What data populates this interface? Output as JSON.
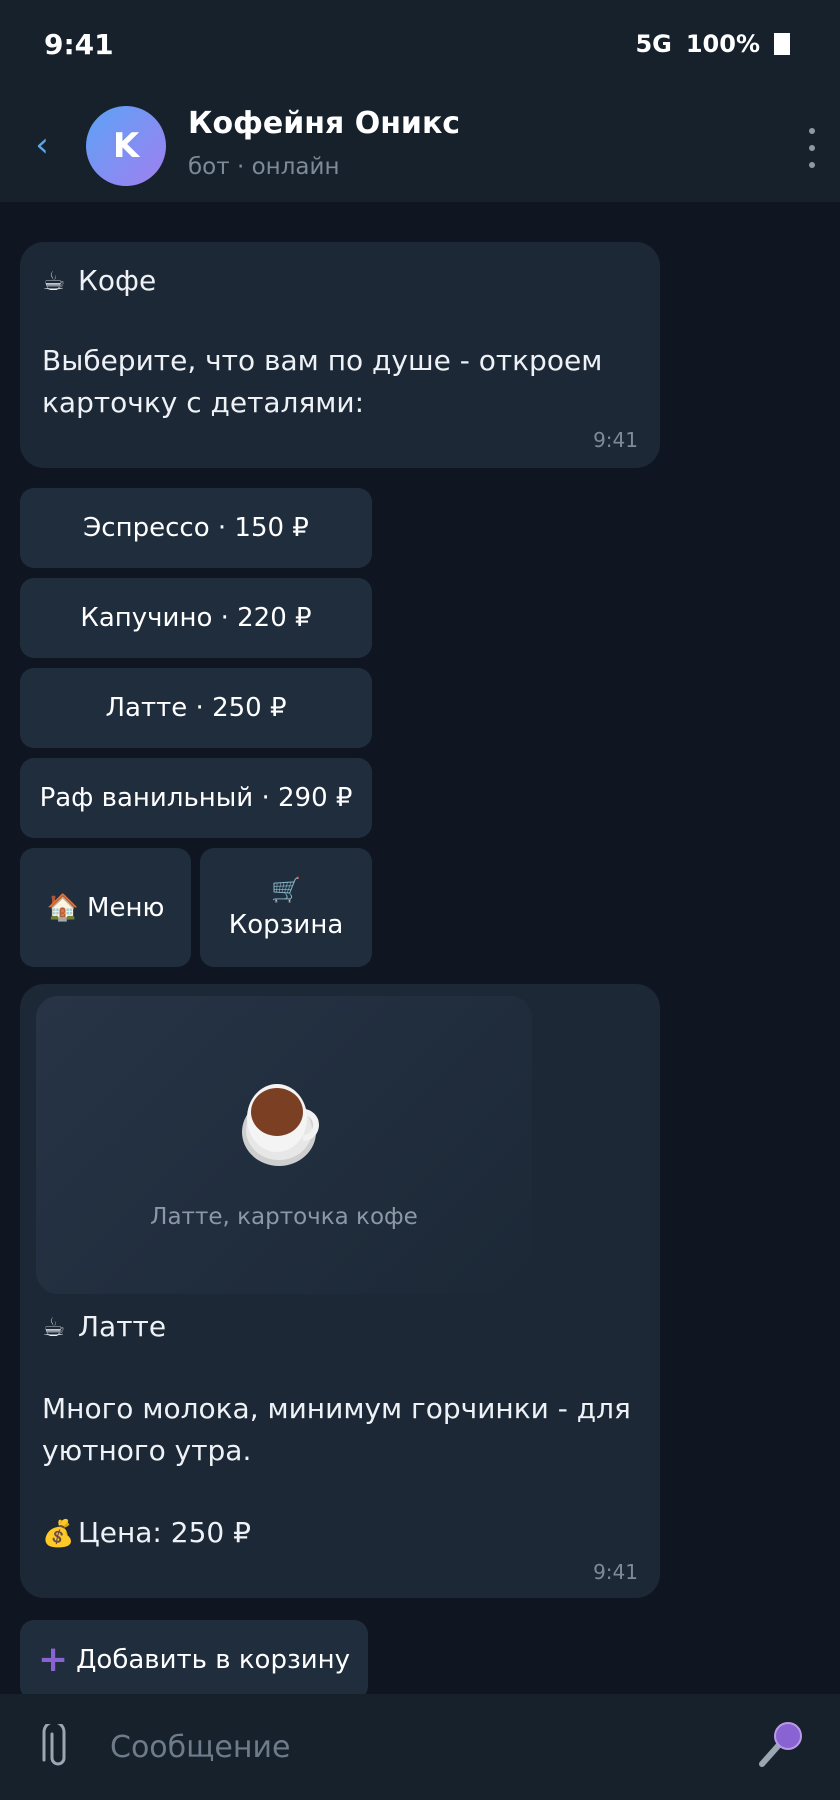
{
  "status": {
    "time": "9:41",
    "network": "5G",
    "battery": "100%"
  },
  "header": {
    "avatar_letter": "K",
    "title": "Кофейня Оникс",
    "subtitle": "бот · онлайн"
  },
  "message1": {
    "heading": "Кофе",
    "body_line1": "Выберите, что вам по душе - откроем",
    "body_line2": "карточку с деталями:",
    "time": "9:41"
  },
  "keyboard": {
    "items": [
      {
        "label": "Эспрессо · 150 ₽"
      },
      {
        "label": "Капучино · 220 ₽"
      },
      {
        "label": "Латте · 250 ₽"
      },
      {
        "label": "Раф ванильный · 290 ₽"
      }
    ],
    "menu_label": "Меню",
    "cart_label": "Корзина"
  },
  "message2": {
    "image_caption": "Латте, карточка кофе",
    "heading": "Латте",
    "body_line1": "Много молока, минимум горчинки - для",
    "body_line2": "уютного утра.",
    "price": "Цена: 250 ₽",
    "time": "9:41"
  },
  "add_to_cart_label": "Добавить в корзину",
  "composer": {
    "placeholder": "Сообщение"
  },
  "icons": {
    "back": "chevron-left-icon",
    "more": "more-vertical-icon",
    "coffee": "coffee-cup-icon",
    "home": "house-icon",
    "cart": "shopping-cart-icon",
    "money": "money-bag-icon",
    "plus": "plus-icon",
    "clip": "paperclip-icon",
    "mic": "microphone-icon"
  },
  "colors": {
    "background": "#0f1621",
    "bar": "#17212b",
    "bubble": "#1c2836",
    "button": "#1f2d3d",
    "accent": "#5ea5e8",
    "plus": "#8a63d2"
  }
}
